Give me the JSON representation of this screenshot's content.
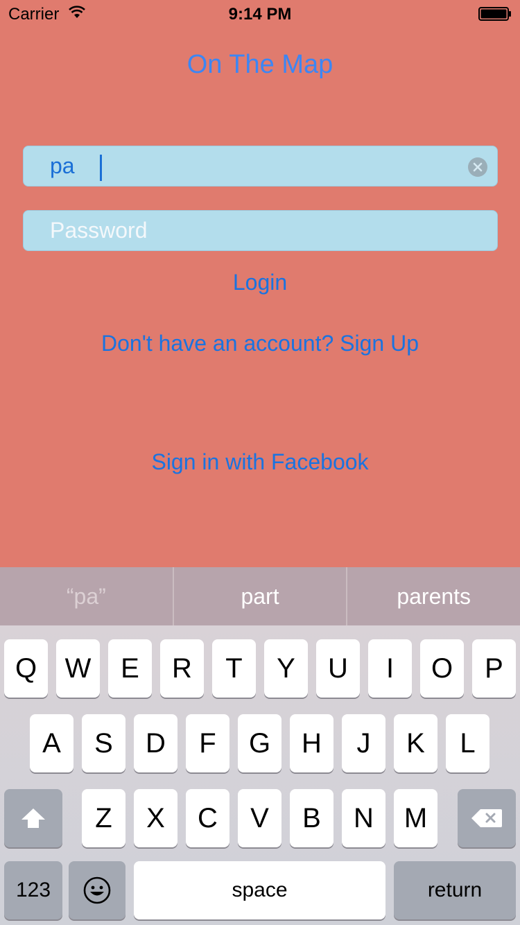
{
  "status_bar": {
    "carrier": "Carrier",
    "time": "9:14 PM"
  },
  "app": {
    "title": "On The Map"
  },
  "login_form": {
    "username_value": "pa",
    "password_placeholder": "Password",
    "login_label": "Login",
    "signup_label": "Don't have an account? Sign Up",
    "facebook_label": "Sign in with Facebook"
  },
  "suggestions": [
    {
      "label": "“pa”"
    },
    {
      "label": "part"
    },
    {
      "label": "parents"
    }
  ],
  "keyboard": {
    "row1": [
      "Q",
      "W",
      "E",
      "R",
      "T",
      "Y",
      "U",
      "I",
      "O",
      "P"
    ],
    "row2": [
      "A",
      "S",
      "D",
      "F",
      "G",
      "H",
      "J",
      "K",
      "L"
    ],
    "row3": [
      "Z",
      "X",
      "C",
      "V",
      "B",
      "N",
      "M"
    ],
    "numbers_label": "123",
    "space_label": "space",
    "return_label": "return"
  },
  "icons": {
    "wifi": "wifi-icon",
    "battery": "battery-icon",
    "clear": "clear-text-icon",
    "shift": "shift-icon",
    "delete": "backspace-icon",
    "emoji": "emoji-icon"
  },
  "colors": {
    "background": "#e07b6e",
    "title": "#3c86f4",
    "link": "#1a73e0",
    "field": "#b3ddec"
  }
}
